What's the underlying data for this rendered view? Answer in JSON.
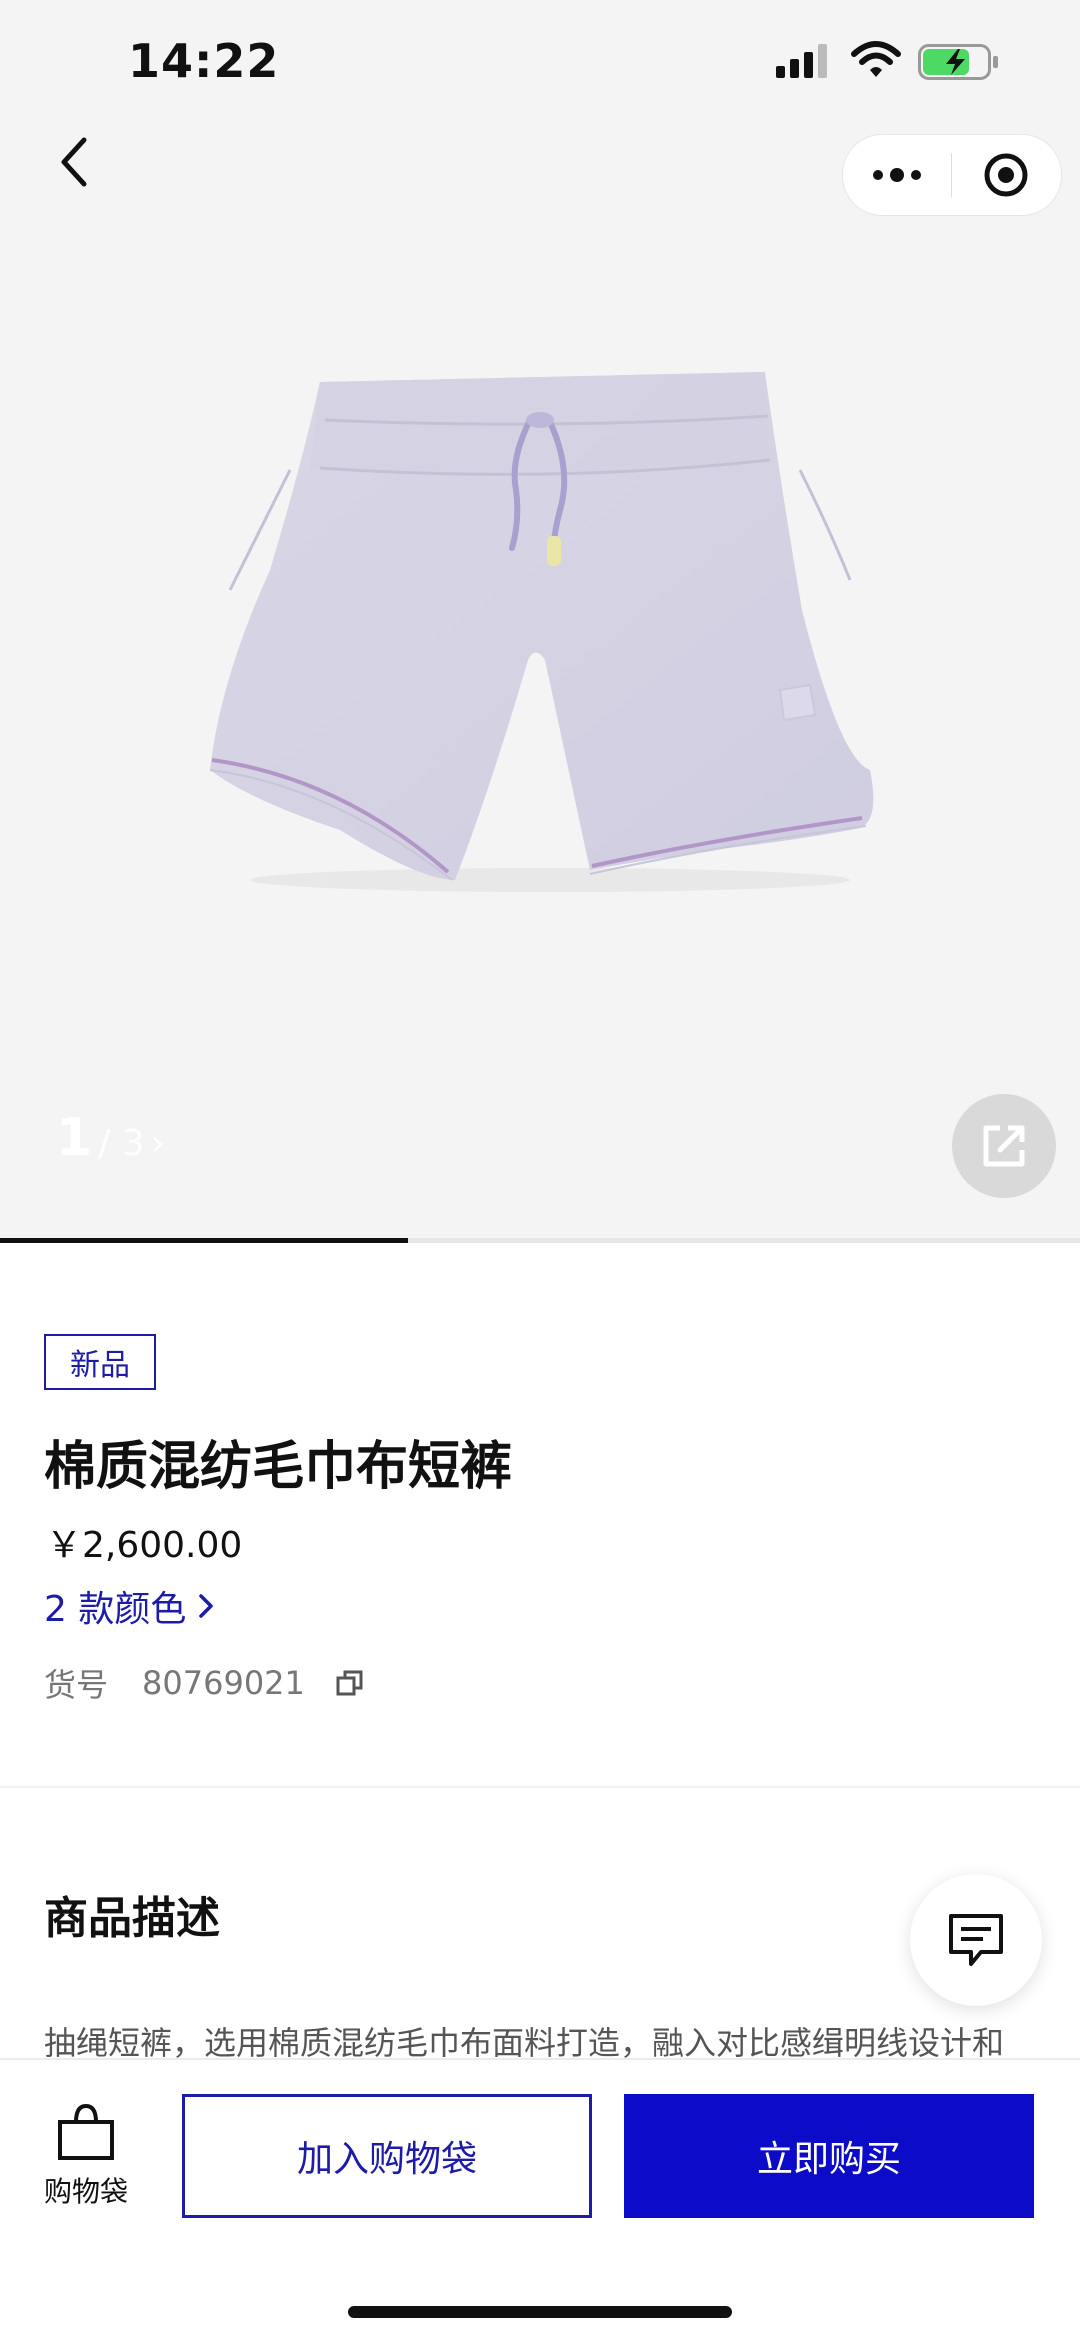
{
  "status_bar": {
    "time": "14:22"
  },
  "gallery": {
    "current": "1",
    "total": "/ 3",
    "next_arrow": "›",
    "progress": 0.378
  },
  "product": {
    "badge": "新品",
    "name": "棉质混纺毛巾布短裤",
    "price": "￥2,600.00",
    "colors_link": "2 款颜色",
    "sku_label": "货号",
    "sku_value": "80769021"
  },
  "description": {
    "title": "商品描述",
    "text": "抽绳短裤，选用棉质混纺毛巾布面料打造，融入对比感缉明线设计和"
  },
  "bottom_bar": {
    "bag_label": "购物袋",
    "add_to_bag": "加入购物袋",
    "buy_now": "立即购买"
  },
  "colors": {
    "brand_blue": "#1c1ca8",
    "buy_button": "#0c0cc8",
    "battery_fill": "#4cd964"
  },
  "icons": [
    "back-arrow-icon",
    "more-dots-icon",
    "target-icon",
    "share-icon",
    "copy-icon",
    "chat-icon",
    "shopping-bag-icon"
  ]
}
